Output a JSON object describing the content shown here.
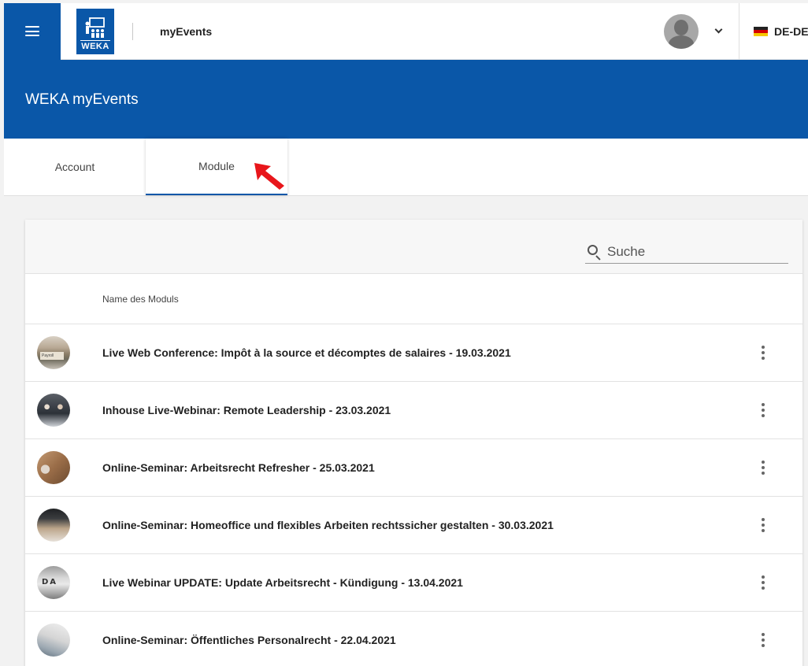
{
  "header": {
    "app_name": "myEvents",
    "logo_text": "WEKA",
    "language": "DE-DE"
  },
  "banner": {
    "title": "WEKA myEvents"
  },
  "tabs": [
    {
      "label": "Account",
      "active": false
    },
    {
      "label": "Module",
      "active": true
    }
  ],
  "search": {
    "placeholder": "Suche",
    "value": ""
  },
  "table": {
    "column_header": "Name des Moduls",
    "rows": [
      {
        "title": "Live Web Conference: Impôt à la source et décomptes de salaires - 19.03.2021",
        "thumb_text": "Payroll"
      },
      {
        "title": "Inhouse Live-Webinar: Remote Leadership - 23.03.2021"
      },
      {
        "title": "Online-Seminar: Arbeitsrecht Refresher - 25.03.2021"
      },
      {
        "title": "Online-Seminar: Homeoffice und flexibles Arbeiten rechtssicher gestalten - 30.03.2021"
      },
      {
        "title": "Live Webinar UPDATE: Update Arbeitsrecht - Kündigung - 13.04.2021",
        "thumb_text": "DA"
      },
      {
        "title": "Online-Seminar: Öffentliches Personalrecht - 22.04.2021"
      }
    ]
  },
  "colors": {
    "brand_blue": "#0a57a8",
    "cursor_red": "#e8161b"
  }
}
